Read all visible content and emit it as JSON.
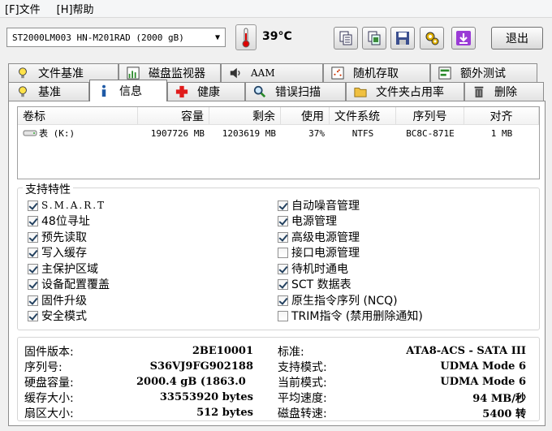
{
  "menu": {
    "file": "[F]文件",
    "help": "[H]帮助"
  },
  "toolbar": {
    "disk": "ST2000LM003 HN-M201RAD (2000 gB)",
    "temperature": "39°C",
    "exit_label": "退出",
    "buttons": [
      "copy-icon",
      "copy-screenshot-icon",
      "save-icon",
      "options-icon",
      "download-icon"
    ]
  },
  "tabs_top": [
    {
      "label": "文件基准",
      "icon": "bulb-icon"
    },
    {
      "label": "磁盘监视器",
      "icon": "chart-icon"
    },
    {
      "label": "AAM",
      "icon": "speaker-icon"
    },
    {
      "label": "随机存取",
      "icon": "random-chart-icon"
    },
    {
      "label": "额外测试",
      "icon": "extra-test-icon"
    }
  ],
  "tabs_bottom": [
    {
      "label": "基准",
      "icon": "bulb-icon"
    },
    {
      "label": "信息",
      "icon": "info-icon",
      "active": true
    },
    {
      "label": "健康",
      "icon": "health-cross-icon"
    },
    {
      "label": "错误扫描",
      "icon": "magnifier-icon"
    },
    {
      "label": "文件夹占用率",
      "icon": "folder-icon"
    },
    {
      "label": "删除",
      "icon": "trash-icon"
    }
  ],
  "volumes": {
    "headers": [
      "卷标",
      "容量",
      "剩余",
      "使用",
      "文件系统",
      "序列号",
      "对齐"
    ],
    "rows": [
      [
        "表 (K:)",
        "1907726 MB",
        "1203619 MB",
        "37%",
        "NTFS",
        "BC8C-871E",
        "1 MB"
      ]
    ]
  },
  "features": {
    "title": "支持特性",
    "left": [
      {
        "label": "S.M.A.R.T",
        "checked": true
      },
      {
        "label": "48位寻址",
        "checked": true
      },
      {
        "label": "预先读取",
        "checked": true
      },
      {
        "label": "写入缓存",
        "checked": true
      },
      {
        "label": "主保护区域",
        "checked": true
      },
      {
        "label": "设备配置覆盖",
        "checked": true
      },
      {
        "label": "固件升级",
        "checked": true
      },
      {
        "label": "安全模式",
        "checked": true
      }
    ],
    "right": [
      {
        "label": "自动噪音管理",
        "checked": true
      },
      {
        "label": "电源管理",
        "checked": true
      },
      {
        "label": "高级电源管理",
        "checked": true
      },
      {
        "label": "接口电源管理",
        "checked": false
      },
      {
        "label": "待机时通电",
        "checked": true
      },
      {
        "label": "SCT 数据表",
        "checked": true
      },
      {
        "label": "原生指令序列 (NCQ)",
        "checked": true
      },
      {
        "label": "TRIM指令 (禁用删除通知)",
        "checked": false
      }
    ]
  },
  "info": {
    "left": [
      {
        "label": "固件版本:",
        "value": "2BE10001"
      },
      {
        "label": "序列号:",
        "value": "S36VJ9FG902188"
      },
      {
        "label": "硬盘容量:",
        "value": "2000.4 gB (1863.0"
      },
      {
        "label": "缓存大小:",
        "value": "33553920 bytes"
      },
      {
        "label": "扇区大小:",
        "value": "512 bytes"
      }
    ],
    "right": [
      {
        "label": "标准:",
        "value": "ATA8-ACS - SATA III"
      },
      {
        "label": "支持模式:",
        "value": "UDMA Mode 6"
      },
      {
        "label": "当前模式:",
        "value": "UDMA Mode 6"
      },
      {
        "label": "平均速度:",
        "value": "94 MB/秒"
      },
      {
        "label": "磁盘转速:",
        "value": "5400 转"
      }
    ]
  }
}
